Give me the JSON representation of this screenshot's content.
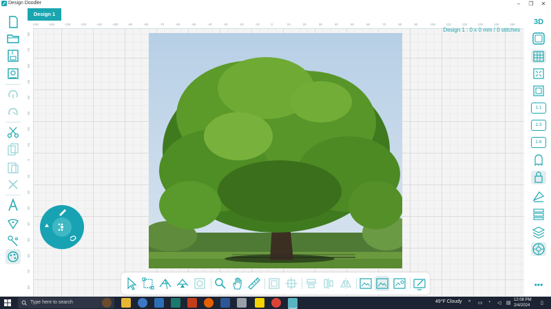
{
  "app": {
    "title": "Design Doodler",
    "window_controls": [
      "–",
      "❐",
      "✕"
    ]
  },
  "tabs": [
    {
      "label": "Design 1"
    }
  ],
  "design_info": "Design 1 : 0 x 0 mm / 0 stitches",
  "ruler": {
    "top_ticks": [
      "-150",
      "-140",
      "-130",
      "-120",
      "-110",
      "-100",
      "-90",
      "-80",
      "-70",
      "-60",
      "-50",
      "-40",
      "-30",
      "-20",
      "-10",
      "0",
      "10",
      "20",
      "30",
      "40",
      "50",
      "60",
      "70",
      "80",
      "90",
      "100",
      "110",
      "120",
      "130",
      "140",
      "150"
    ],
    "left_ticks": [
      "-80",
      "-70",
      "-60",
      "-50",
      "-40",
      "-30",
      "-20",
      "-10",
      "0",
      "10",
      "20",
      "30",
      "40",
      "50",
      "60",
      "70",
      "80"
    ]
  },
  "left_toolbar": [
    "new-file-icon",
    "open-folder-icon",
    "save-icon",
    "export-icon",
    "undo-icon",
    "redo-icon",
    "cut-icon",
    "copy-icon",
    "paste-icon",
    "delete-icon",
    "text-icon",
    "pen-nib-icon",
    "magic-wand-icon",
    "palette-icon"
  ],
  "right_toolbar": {
    "top_label": "3D",
    "ratios": [
      "1:1",
      "1:3",
      "1:6"
    ]
  },
  "bottom_toolbar": [
    "select-icon",
    "crop-select-icon",
    "node-edit-icon",
    "node-add-icon",
    "lasso-icon",
    "zoom-icon",
    "hand-pan-icon",
    "measure-icon",
    "fit-icon",
    "resize-icon",
    "align-center-icon",
    "align-middle-icon",
    "flip-icon",
    "image-icon",
    "image-active-icon",
    "image-edit-icon",
    "trace-icon"
  ],
  "taskbar": {
    "search_placeholder": "Type here to search",
    "weather": "49°F  Cloudy",
    "time": "12:08 PM",
    "date": "2/4/2024"
  },
  "colors": {
    "accent": "#1aa6b0",
    "taskbar": "#1c2333"
  }
}
